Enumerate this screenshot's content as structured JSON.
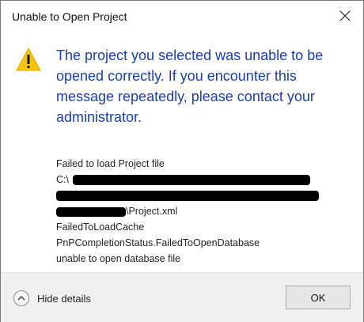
{
  "dialog": {
    "title": "Unable to Open Project",
    "close_icon": "close-icon",
    "warning_icon": "warning-icon",
    "main_instruction": "The project you selected was unable to be opened correctly. If you encounter this message repeatedly, please contact your administrator.",
    "details": {
      "line1": "Failed to load Project file",
      "line2_prefix": "C:\\",
      "line4_suffix": "\\Project.xml",
      "line5": "FailedToLoadCache",
      "line6": "PnPCompletionStatus.FailedToOpenDatabase",
      "line7": "unable to open database file"
    },
    "footer": {
      "toggle_label": "Hide details",
      "toggle_icon": "chevron-up-icon",
      "ok_label": "OK"
    },
    "colors": {
      "instruction_text": "#1a3fa8",
      "warning_fill": "#f7c600",
      "footer_bg": "#f0f0f0"
    }
  }
}
